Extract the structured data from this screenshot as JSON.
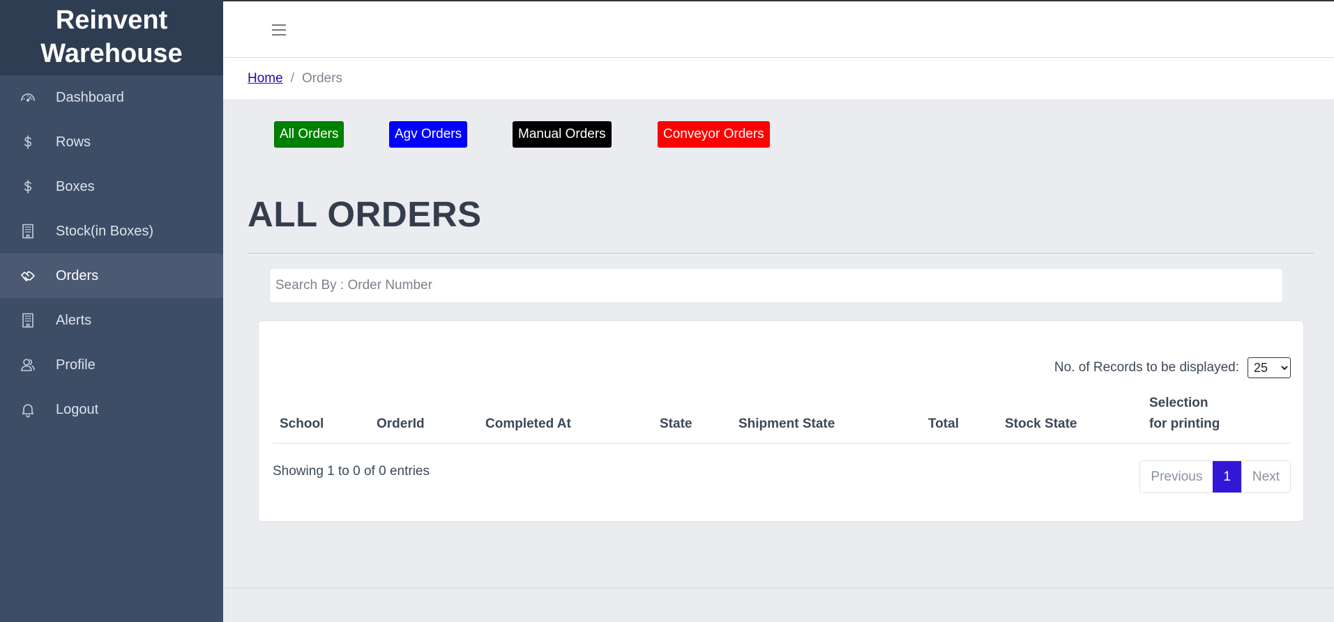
{
  "app": {
    "brand": "Reinvent Warehouse"
  },
  "sidebar": {
    "items": [
      {
        "label": "Dashboard",
        "icon": "speedometer-icon",
        "active": false
      },
      {
        "label": "Rows",
        "icon": "dollar-icon",
        "active": false
      },
      {
        "label": "Boxes",
        "icon": "dollar-icon",
        "active": false
      },
      {
        "label": "Stock(in Boxes)",
        "icon": "building-icon",
        "active": false
      },
      {
        "label": "Orders",
        "icon": "handshake-icon",
        "active": true
      },
      {
        "label": "Alerts",
        "icon": "building-icon",
        "active": false
      },
      {
        "label": "Profile",
        "icon": "users-icon",
        "active": false
      },
      {
        "label": "Logout",
        "icon": "bell-icon",
        "active": false
      }
    ]
  },
  "topbar": {
    "menu_icon": "hamburger-icon"
  },
  "breadcrumb": {
    "home": "Home",
    "separator": "/",
    "current": "Orders"
  },
  "filters": [
    {
      "label": "All Orders",
      "color": "#008000"
    },
    {
      "label": "Agv Orders",
      "color": "#0000ff"
    },
    {
      "label": "Manual Orders",
      "color": "#000000"
    },
    {
      "label": "Conveyor Orders",
      "color": "#ff0000"
    }
  ],
  "main": {
    "title": "ALL ORDERS",
    "search_placeholder": "Search By : Order Number"
  },
  "table": {
    "records_label": "No. of Records to be displayed:",
    "records_value": "25",
    "columns": [
      "School",
      "OrderId",
      "Completed At",
      "State",
      "Shipment State",
      "Total",
      "Stock State",
      "Selection\nfor printing"
    ],
    "rows": [],
    "info": "Showing 1 to 0 of 0 entries"
  },
  "pagination": {
    "previous": "Previous",
    "current": "1",
    "next": "Next",
    "active_color": "#3218d6"
  }
}
